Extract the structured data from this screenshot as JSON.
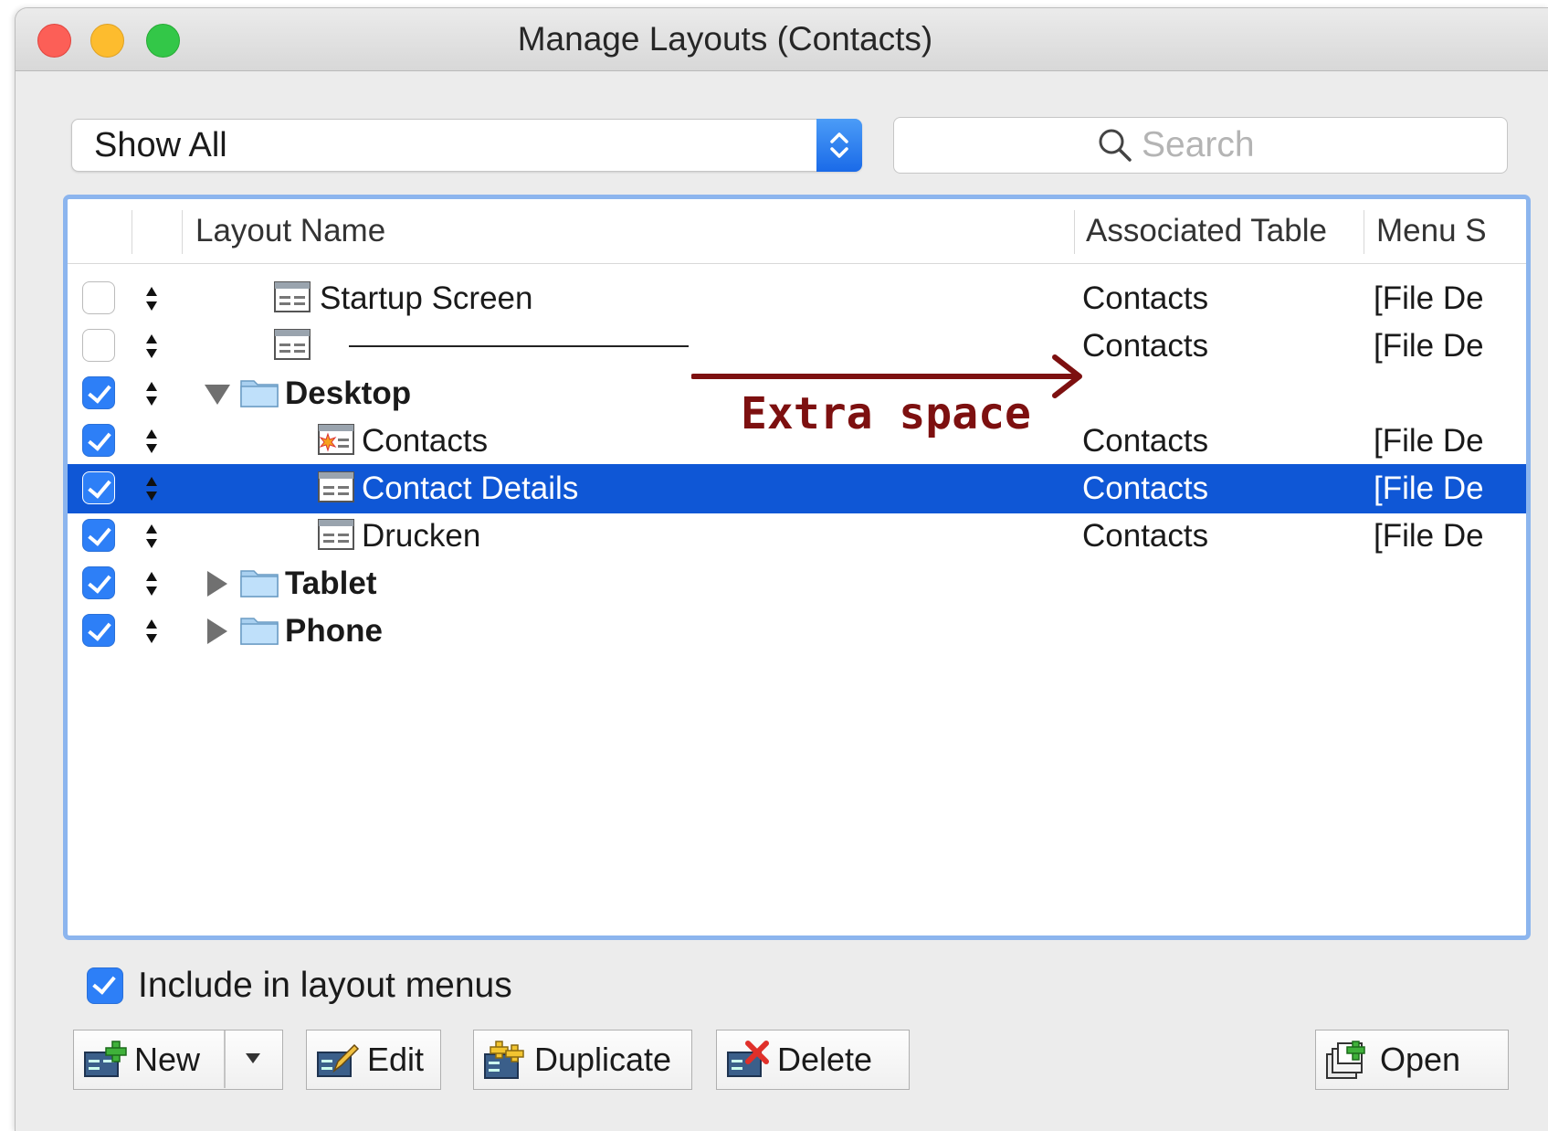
{
  "window": {
    "title": "Manage Layouts (Contacts)"
  },
  "filter": {
    "selected": "Show All"
  },
  "search": {
    "placeholder": "Search"
  },
  "table": {
    "headers": [
      "Layout Name",
      "Associated Table",
      "Menu S"
    ],
    "rows": [
      {
        "checked": false,
        "name": "Startup Screen",
        "table": "Contacts",
        "menu": "[File De",
        "icon": "layout-icon"
      },
      {
        "checked": false,
        "name": "",
        "table": "Contacts",
        "menu": "[File De",
        "icon": "layout-icon"
      },
      {
        "checked": true,
        "name": "Desktop",
        "table": "",
        "menu": "",
        "icon": "folder-icon"
      },
      {
        "checked": true,
        "name": "Contacts",
        "table": "Contacts",
        "menu": "[File De",
        "icon": "startup-layout-icon"
      },
      {
        "checked": true,
        "name": "Contact Details",
        "table": "Contacts",
        "menu": "[File De",
        "icon": "layout-icon"
      },
      {
        "checked": true,
        "name": "Drucken",
        "table": "Contacts",
        "menu": "[File De",
        "icon": "layout-icon"
      },
      {
        "checked": true,
        "name": "Tablet",
        "table": "",
        "menu": "",
        "icon": "folder-icon"
      },
      {
        "checked": true,
        "name": "Phone",
        "table": "",
        "menu": "",
        "icon": "folder-icon"
      }
    ]
  },
  "annotation": {
    "text": "Extra space",
    "color": "#7d1010"
  },
  "include": {
    "label": "Include in layout menus",
    "checked": true
  },
  "buttons": {
    "new": "New",
    "edit": "Edit",
    "duplicate": "Duplicate",
    "delete": "Delete",
    "open": "Open"
  },
  "colors": {
    "accent": "#2d7ff7",
    "selection": "#0f57d6",
    "focus_ring": "#8cb5ee"
  }
}
